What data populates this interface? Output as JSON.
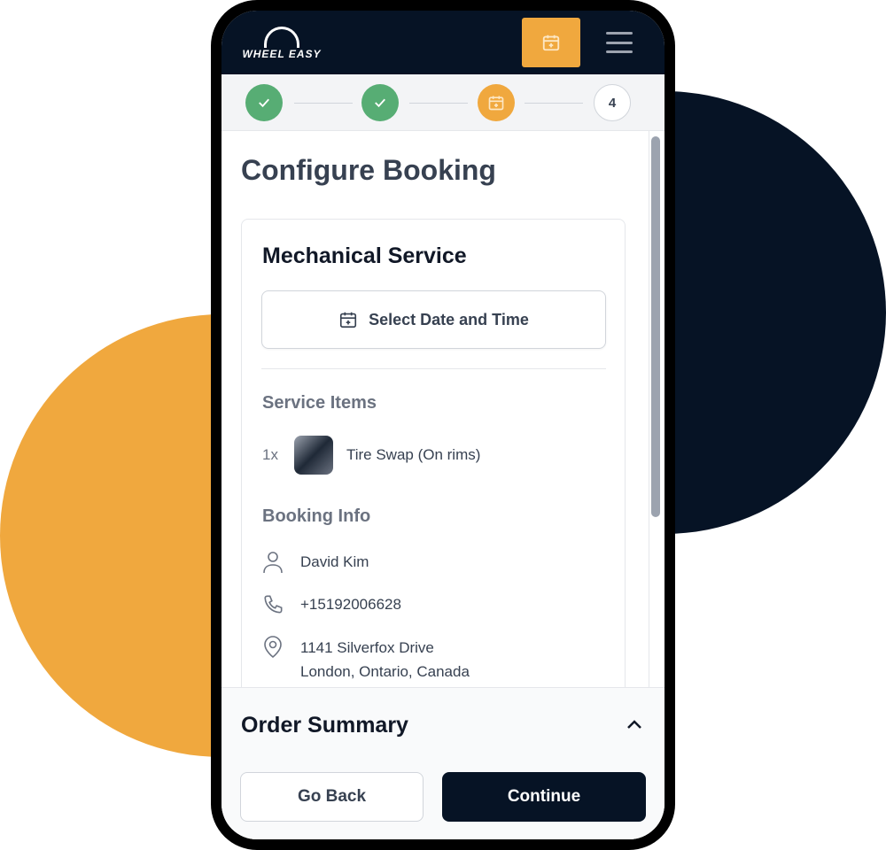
{
  "brand": {
    "logo_text": "WHEEL EASY",
    "accent": "#f0a83e",
    "navy": "#061325",
    "success": "#57ad74"
  },
  "header": {
    "calendar_icon": "calendar-plus-icon",
    "menu_icon": "hamburger-icon"
  },
  "stepper": {
    "steps": [
      {
        "state": "complete"
      },
      {
        "state": "complete"
      },
      {
        "state": "current"
      },
      {
        "state": "pending",
        "label": "4"
      }
    ]
  },
  "page": {
    "title": "Configure Booking"
  },
  "card": {
    "title": "Mechanical Service",
    "date_button": "Select Date and Time",
    "service_items_heading": "Service Items",
    "items": [
      {
        "qty": "1x",
        "name": "Tire Swap (On rims)"
      }
    ],
    "booking_info_heading": "Booking Info",
    "name": "David Kim",
    "phone": "+15192006628",
    "address_line1": "1141 Silverfox Drive",
    "address_line2": "London, Ontario, Canada"
  },
  "footer": {
    "summary": "Order Summary",
    "back": "Go Back",
    "continue": "Continue"
  }
}
